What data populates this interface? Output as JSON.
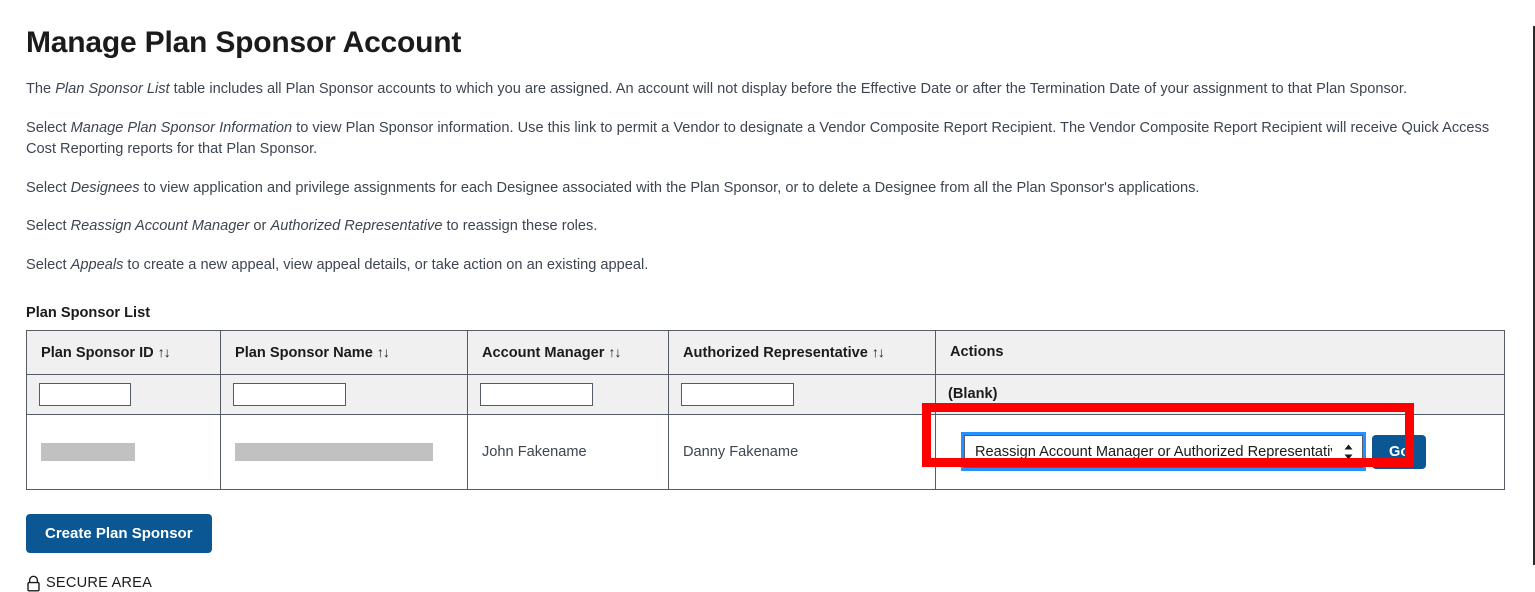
{
  "page": {
    "title": "Manage Plan Sponsor Account",
    "paragraphs": [
      {
        "parts": [
          {
            "text": "The ",
            "italic": false
          },
          {
            "text": "Plan Sponsor List",
            "italic": true
          },
          {
            "text": " table includes all Plan Sponsor accounts to which you are assigned. An account will not display before the Effective Date or after the Termination Date of your assignment to that Plan Sponsor.",
            "italic": false
          }
        ]
      },
      {
        "parts": [
          {
            "text": "Select ",
            "italic": false
          },
          {
            "text": "Manage Plan Sponsor Information",
            "italic": true
          },
          {
            "text": " to view Plan Sponsor information. Use this link to permit a Vendor to designate a Vendor Composite Report Recipient. The Vendor Composite Report Recipient will receive Quick Access Cost Reporting reports for that Plan Sponsor.",
            "italic": false
          }
        ]
      },
      {
        "parts": [
          {
            "text": "Select ",
            "italic": false
          },
          {
            "text": "Designees",
            "italic": true
          },
          {
            "text": " to view application and privilege assignments for each Designee associated with the Plan Sponsor, or to delete a Designee from all the Plan Sponsor's applications.",
            "italic": false
          }
        ]
      },
      {
        "parts": [
          {
            "text": "Select ",
            "italic": false
          },
          {
            "text": "Reassign Account Manager",
            "italic": true
          },
          {
            "text": " or ",
            "italic": false
          },
          {
            "text": "Authorized Representative",
            "italic": true
          },
          {
            "text": " to reassign these roles.",
            "italic": false
          }
        ]
      },
      {
        "parts": [
          {
            "text": "Select ",
            "italic": false
          },
          {
            "text": "Appeals",
            "italic": true
          },
          {
            "text": " to create a new appeal, view appeal details, or take action on an existing appeal.",
            "italic": false
          }
        ]
      }
    ]
  },
  "table": {
    "caption": "Plan Sponsor List",
    "sort_glyph": "↑↓",
    "columns": [
      {
        "label": "Plan Sponsor ID",
        "sortable": true
      },
      {
        "label": "Plan Sponsor Name",
        "sortable": true
      },
      {
        "label": "Account Manager",
        "sortable": true
      },
      {
        "label": "Authorized Representative",
        "sortable": true
      },
      {
        "label": "Actions",
        "sortable": false
      }
    ],
    "filter_row": {
      "plan_sponsor_id": "",
      "plan_sponsor_name": "",
      "account_manager": "",
      "authorized_representative": "",
      "actions": "(Blank)"
    },
    "rows": [
      {
        "plan_sponsor_id": "",
        "plan_sponsor_id_redacted": true,
        "plan_sponsor_name": "",
        "plan_sponsor_name_redacted": true,
        "account_manager": "John Fakename",
        "authorized_representative": "Danny Fakename",
        "action_select_value": "Reassign Account Manager or Authorized Representative",
        "action_go_label": "Go"
      }
    ]
  },
  "buttons": {
    "create_plan_sponsor": "Create Plan Sponsor"
  },
  "footer": {
    "secure_area_label": "SECURE AREA",
    "lock_icon": "lock-icon"
  },
  "colors": {
    "primary_blue": "#0b5794",
    "focus_blue": "#2491ff",
    "highlight_red": "#fe0000",
    "header_gray": "#f0f0f0",
    "redaction_gray": "#c1c1c1",
    "border_gray": "#565c65"
  }
}
